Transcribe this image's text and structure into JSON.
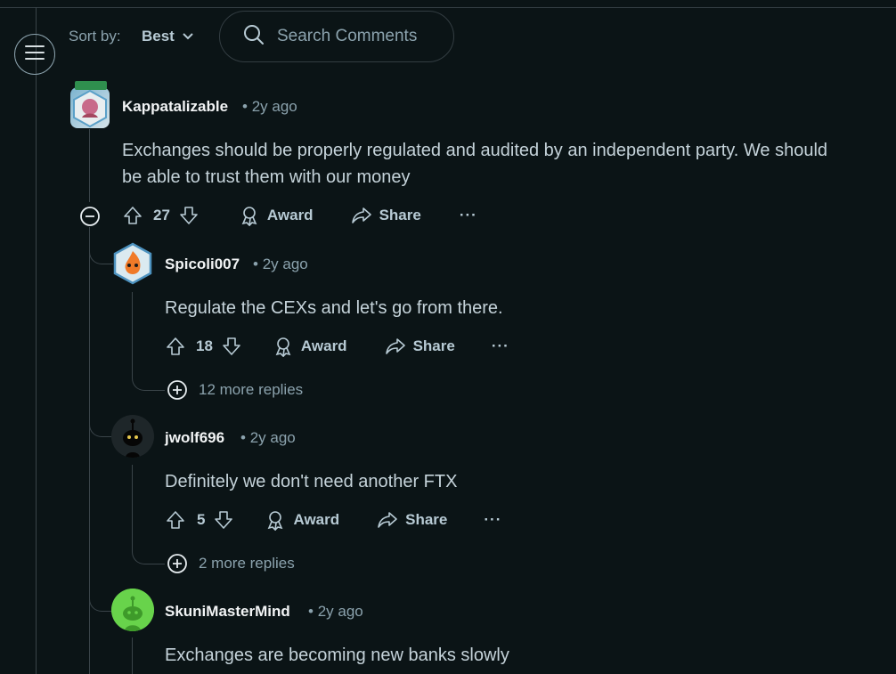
{
  "sort": {
    "label": "Sort by:",
    "value": "Best"
  },
  "search": {
    "placeholder": "Search Comments"
  },
  "comments": [
    {
      "author": "Kappatalizable",
      "time": "2y ago",
      "text_lines": [
        "Exchanges should be properly regulated and audited by an independent party. We should",
        "be able to trust them with our money"
      ],
      "votes": "27",
      "award": "Award",
      "share": "Share",
      "more": "···"
    },
    {
      "author": "Spicoli007",
      "time": "2y ago",
      "text": "Regulate the CEXs and let's go from there.",
      "votes": "18",
      "award": "Award",
      "share": "Share",
      "more": "···",
      "more_replies": "12 more replies"
    },
    {
      "author": "jwolf696",
      "time": "2y ago",
      "text": "Definitely we don't need another FTX",
      "votes": "5",
      "award": "Award",
      "share": "Share",
      "more": "···",
      "more_replies": "2 more replies"
    },
    {
      "author": "SkuniMasterMind",
      "time": "2y ago",
      "text": "Exchanges are becoming new banks slowly"
    }
  ],
  "colors": {
    "background": "#0b1416",
    "text": "#c5d3da",
    "muted": "#8ba2ad",
    "author": "#f2f4f5",
    "thread_line": "#3a4449"
  },
  "icons": [
    "menu-icon",
    "chevron-down-icon",
    "search-icon",
    "collapse-icon",
    "upvote-icon",
    "downvote-icon",
    "award-icon",
    "share-icon",
    "expand-icon"
  ]
}
